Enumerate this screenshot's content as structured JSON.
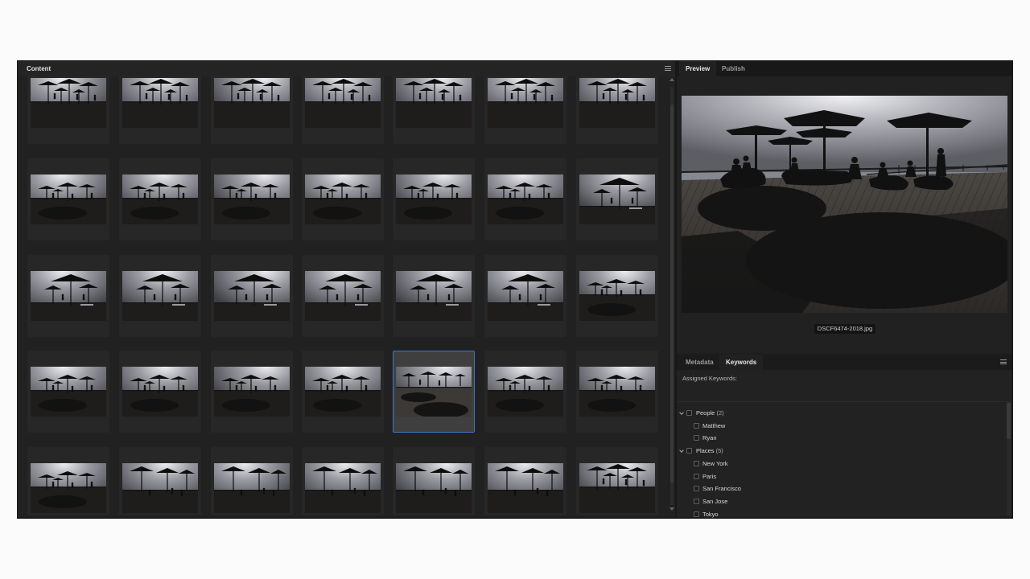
{
  "content_panel": {
    "title": "Content",
    "menu_icon": "hamburger-menu-icon"
  },
  "thumbnails": {
    "columns": 7,
    "rows": 5,
    "selected_index": 25,
    "items": [
      {
        "variant": "far"
      },
      {
        "variant": "far"
      },
      {
        "variant": "far"
      },
      {
        "variant": "far"
      },
      {
        "variant": "far"
      },
      {
        "variant": "far"
      },
      {
        "variant": "far"
      },
      {
        "variant": "deck"
      },
      {
        "variant": "deck"
      },
      {
        "variant": "deck"
      },
      {
        "variant": "deck"
      },
      {
        "variant": "deck"
      },
      {
        "variant": "deck"
      },
      {
        "variant": "near"
      },
      {
        "variant": "near"
      },
      {
        "variant": "near"
      },
      {
        "variant": "near"
      },
      {
        "variant": "near"
      },
      {
        "variant": "near"
      },
      {
        "variant": "near"
      },
      {
        "variant": "deck"
      },
      {
        "variant": "deck"
      },
      {
        "variant": "deck"
      },
      {
        "variant": "deck"
      },
      {
        "variant": "deck"
      },
      {
        "variant": "shadow"
      },
      {
        "variant": "deck"
      },
      {
        "variant": "deck"
      },
      {
        "variant": "deck"
      },
      {
        "variant": "low"
      },
      {
        "variant": "low"
      },
      {
        "variant": "low"
      },
      {
        "variant": "low"
      },
      {
        "variant": "low"
      },
      {
        "variant": "far"
      }
    ]
  },
  "right_panel": {
    "tabs": [
      {
        "label": "Preview",
        "active": true
      },
      {
        "label": "Publish",
        "active": false
      }
    ],
    "preview_filename": "DSCF6474-2018.jpg"
  },
  "keywords_panel": {
    "tabs": [
      {
        "label": "Metadata",
        "active": false
      },
      {
        "label": "Keywords",
        "active": true
      }
    ],
    "menu_icon": "hamburger-menu-icon",
    "assigned_label": "Assigned Keywords:",
    "groups": [
      {
        "label": "People",
        "count": "(2)",
        "expanded": true,
        "children": [
          {
            "label": "Matthew",
            "checked": false
          },
          {
            "label": "Ryan",
            "checked": false
          }
        ]
      },
      {
        "label": "Places",
        "count": "(5)",
        "expanded": true,
        "children": [
          {
            "label": "New York",
            "checked": false
          },
          {
            "label": "Paris",
            "checked": false
          },
          {
            "label": "San Francisco",
            "checked": false
          },
          {
            "label": "San Jose",
            "checked": false
          },
          {
            "label": "Tokyo",
            "checked": false
          }
        ]
      }
    ]
  }
}
